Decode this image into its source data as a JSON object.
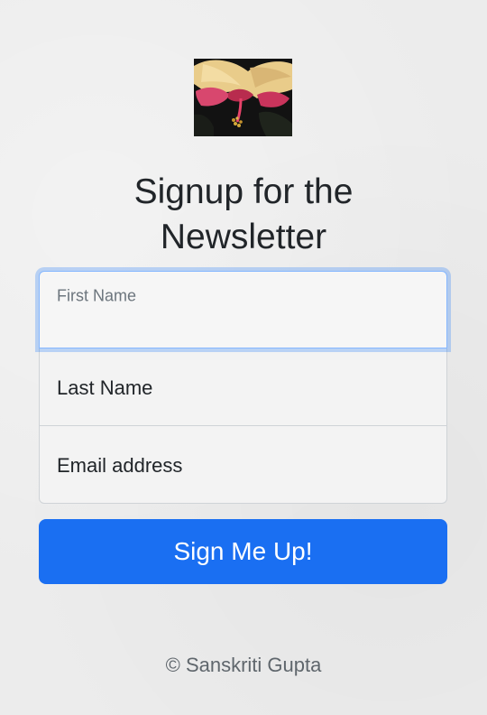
{
  "header": {
    "logo_icon": "hibiscus-flower-photo",
    "title_line1": "Signup for the",
    "title_line2": "Newsletter"
  },
  "form": {
    "first_name": {
      "label": "First Name",
      "value": ""
    },
    "last_name": {
      "label": "Last Name",
      "value": ""
    },
    "email": {
      "label": "Email address",
      "value": ""
    },
    "submit_label": "Sign Me Up!"
  },
  "footer": {
    "text": "© Sanskriti Gupta"
  },
  "colors": {
    "accent": "#1a6ff2",
    "focus_ring": "#86b7fe",
    "background": "#ececec"
  }
}
